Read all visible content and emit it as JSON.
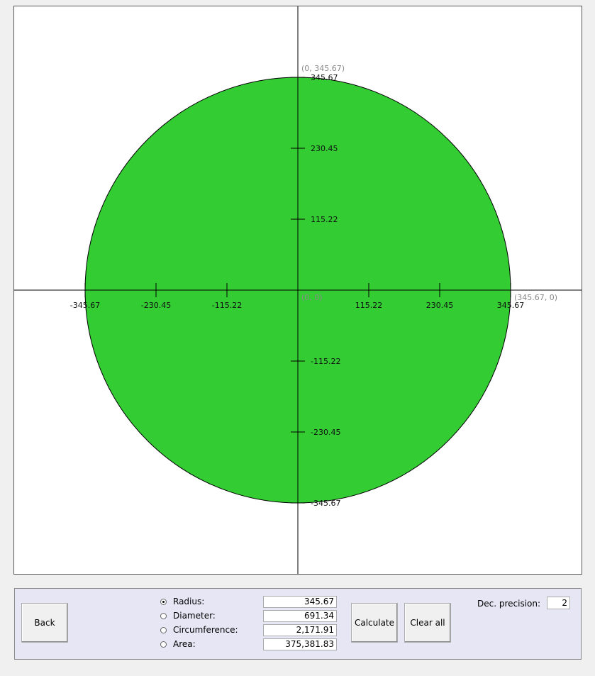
{
  "plot": {
    "tick_values": [
      "-345.67",
      "-230.45",
      "-115.22",
      "115.22",
      "230.45",
      "345.67"
    ],
    "origin_label": "(0, 0)",
    "top_point_label": "(0, 345.67)",
    "right_point_label": "(345.67, 0)",
    "circle_fill": "#33cc33",
    "radius": 345.67
  },
  "controls": {
    "back_label": "Back",
    "calculate_label": "Calculate",
    "clear_label": "Clear all",
    "precision_label": "Dec. precision:",
    "precision_value": "2",
    "options": [
      {
        "label": "Radius:",
        "value": "345.67",
        "checked": true
      },
      {
        "label": "Diameter:",
        "value": "691.34",
        "checked": false
      },
      {
        "label": "Circumference:",
        "value": "2,171.91",
        "checked": false
      },
      {
        "label": "Area:",
        "value": "375,381.83",
        "checked": false
      }
    ]
  }
}
